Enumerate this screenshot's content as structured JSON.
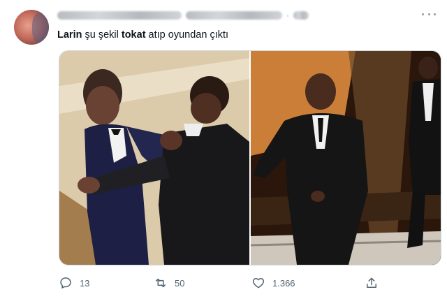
{
  "tweet": {
    "text_segments": [
      {
        "text": "Larin",
        "bold": true
      },
      {
        "text": " şu şekil ",
        "bold": false
      },
      {
        "text": "tokat",
        "bold": true
      },
      {
        "text": " atıp oyundan çıktı",
        "bold": false
      }
    ]
  },
  "media": {
    "count": 2,
    "description_icons": [
      "slap-photo",
      "walk-photo"
    ]
  },
  "actions": {
    "reply": {
      "icon": "reply-icon",
      "count": "13"
    },
    "retweet": {
      "icon": "retweet-icon",
      "count": "50"
    },
    "like": {
      "icon": "heart-icon",
      "count": "1.366"
    },
    "share": {
      "icon": "share-icon",
      "count": ""
    }
  },
  "colors": {
    "text": "#0f1419",
    "muted": "#536471",
    "border": "#cfd9de"
  }
}
